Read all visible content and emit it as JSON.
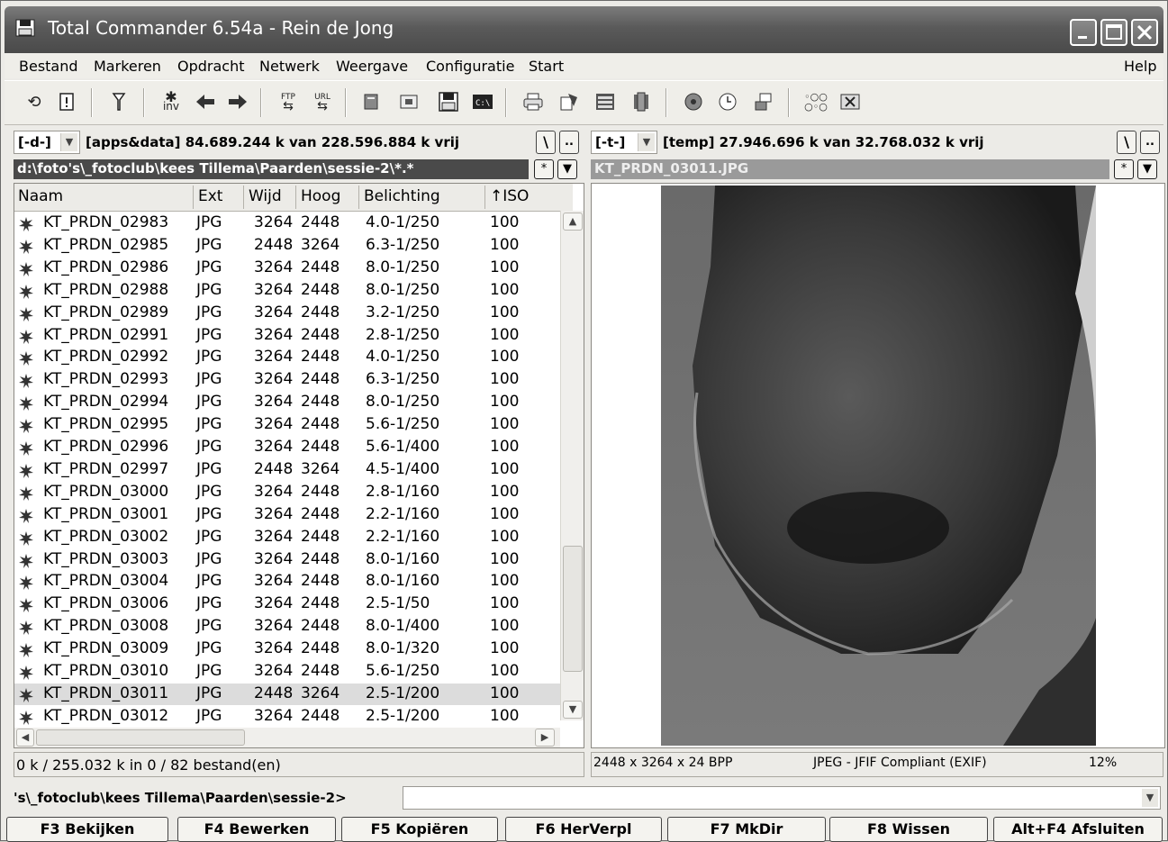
{
  "window": {
    "title": "Total Commander 6.54a - Rein de Jong"
  },
  "menu": {
    "items": [
      "Bestand",
      "Markeren",
      "Opdracht",
      "Netwerk",
      "Weergave",
      "Configuratie",
      "Start"
    ],
    "help": "Help"
  },
  "toolbar": {
    "icons": [
      "refresh-icon",
      "brief-view-icon",
      "filter-icon",
      "invert-selection-icon",
      "back-arrow-icon",
      "forward-arrow-icon",
      "ftp-connect-icon",
      "url-connect-icon",
      "pack-icon",
      "unpack-icon",
      "save-icon",
      "command-prompt-icon",
      "printer-icon",
      "copy-names-icon",
      "compare-icon",
      "sync-dirs-icon",
      "multimedia-icon",
      "clock-icon",
      "network-drives-icon",
      "tree-icon",
      "excel-icon"
    ]
  },
  "left": {
    "drive": "[-d-]",
    "drive_info": "[apps&data]  84.689.244 k van 228.596.884 k vrij",
    "root_btn": "\\",
    "up_btn": "..",
    "path": "d:\\foto's\\_fotoclub\\kees Tillema\\Paarden\\sessie-2\\*.*",
    "columns": [
      "Naam",
      "Ext",
      "Wijd",
      "Hoog",
      "Belichting",
      "↑ISO"
    ],
    "files": [
      {
        "name": "KT_PRDN_02983",
        "ext": "JPG",
        "w": "3264",
        "h": "2448",
        "exp": "4.0-1/250",
        "iso": "100"
      },
      {
        "name": "KT_PRDN_02985",
        "ext": "JPG",
        "w": "2448",
        "h": "3264",
        "exp": "6.3-1/250",
        "iso": "100"
      },
      {
        "name": "KT_PRDN_02986",
        "ext": "JPG",
        "w": "3264",
        "h": "2448",
        "exp": "8.0-1/250",
        "iso": "100"
      },
      {
        "name": "KT_PRDN_02988",
        "ext": "JPG",
        "w": "3264",
        "h": "2448",
        "exp": "8.0-1/250",
        "iso": "100"
      },
      {
        "name": "KT_PRDN_02989",
        "ext": "JPG",
        "w": "3264",
        "h": "2448",
        "exp": "3.2-1/250",
        "iso": "100"
      },
      {
        "name": "KT_PRDN_02991",
        "ext": "JPG",
        "w": "3264",
        "h": "2448",
        "exp": "2.8-1/250",
        "iso": "100"
      },
      {
        "name": "KT_PRDN_02992",
        "ext": "JPG",
        "w": "3264",
        "h": "2448",
        "exp": "4.0-1/250",
        "iso": "100"
      },
      {
        "name": "KT_PRDN_02993",
        "ext": "JPG",
        "w": "3264",
        "h": "2448",
        "exp": "6.3-1/250",
        "iso": "100"
      },
      {
        "name": "KT_PRDN_02994",
        "ext": "JPG",
        "w": "3264",
        "h": "2448",
        "exp": "8.0-1/250",
        "iso": "100"
      },
      {
        "name": "KT_PRDN_02995",
        "ext": "JPG",
        "w": "3264",
        "h": "2448",
        "exp": "5.6-1/250",
        "iso": "100"
      },
      {
        "name": "KT_PRDN_02996",
        "ext": "JPG",
        "w": "3264",
        "h": "2448",
        "exp": "5.6-1/400",
        "iso": "100"
      },
      {
        "name": "KT_PRDN_02997",
        "ext": "JPG",
        "w": "2448",
        "h": "3264",
        "exp": "4.5-1/400",
        "iso": "100"
      },
      {
        "name": "KT_PRDN_03000",
        "ext": "JPG",
        "w": "3264",
        "h": "2448",
        "exp": "2.8-1/160",
        "iso": "100"
      },
      {
        "name": "KT_PRDN_03001",
        "ext": "JPG",
        "w": "3264",
        "h": "2448",
        "exp": "2.2-1/160",
        "iso": "100"
      },
      {
        "name": "KT_PRDN_03002",
        "ext": "JPG",
        "w": "3264",
        "h": "2448",
        "exp": "2.2-1/160",
        "iso": "100"
      },
      {
        "name": "KT_PRDN_03003",
        "ext": "JPG",
        "w": "3264",
        "h": "2448",
        "exp": "8.0-1/160",
        "iso": "100"
      },
      {
        "name": "KT_PRDN_03004",
        "ext": "JPG",
        "w": "3264",
        "h": "2448",
        "exp": "8.0-1/160",
        "iso": "100"
      },
      {
        "name": "KT_PRDN_03006",
        "ext": "JPG",
        "w": "3264",
        "h": "2448",
        "exp": "2.5-1/50",
        "iso": "100"
      },
      {
        "name": "KT_PRDN_03008",
        "ext": "JPG",
        "w": "3264",
        "h": "2448",
        "exp": "8.0-1/400",
        "iso": "100"
      },
      {
        "name": "KT_PRDN_03009",
        "ext": "JPG",
        "w": "3264",
        "h": "2448",
        "exp": "8.0-1/320",
        "iso": "100"
      },
      {
        "name": "KT_PRDN_03010",
        "ext": "JPG",
        "w": "3264",
        "h": "2448",
        "exp": "5.6-1/250",
        "iso": "100"
      },
      {
        "name": "KT_PRDN_03011",
        "ext": "JPG",
        "w": "2448",
        "h": "3264",
        "exp": "2.5-1/200",
        "iso": "100",
        "selected": true
      },
      {
        "name": "KT_PRDN_03012",
        "ext": "JPG",
        "w": "3264",
        "h": "2448",
        "exp": "2.5-1/200",
        "iso": "100"
      }
    ],
    "status": "0 k / 255.032 k in 0 / 82 bestand(en)"
  },
  "right": {
    "drive": "[-t-]",
    "drive_info": "[temp]  27.946.696 k van 32.768.032 k vrij",
    "root_btn": "\\",
    "up_btn": "..",
    "path": "KT_PRDN_03011.JPG",
    "image_info": "2448 x 3264 x 24 BPP",
    "format": "JPEG - JFIF Compliant (EXIF)",
    "zoom": "12%"
  },
  "commandline": {
    "prompt": "'s\\_fotoclub\\kees Tillema\\Paarden\\sessie-2>"
  },
  "fkeys": [
    "F3 Bekijken",
    "F4 Bewerken",
    "F5 Kopiëren",
    "F6 HerVerpl",
    "F7 MkDir",
    "F8 Wissen",
    "Alt+F4 Afsluiten"
  ],
  "path_buttons": {
    "star": "*",
    "history": "▼"
  }
}
